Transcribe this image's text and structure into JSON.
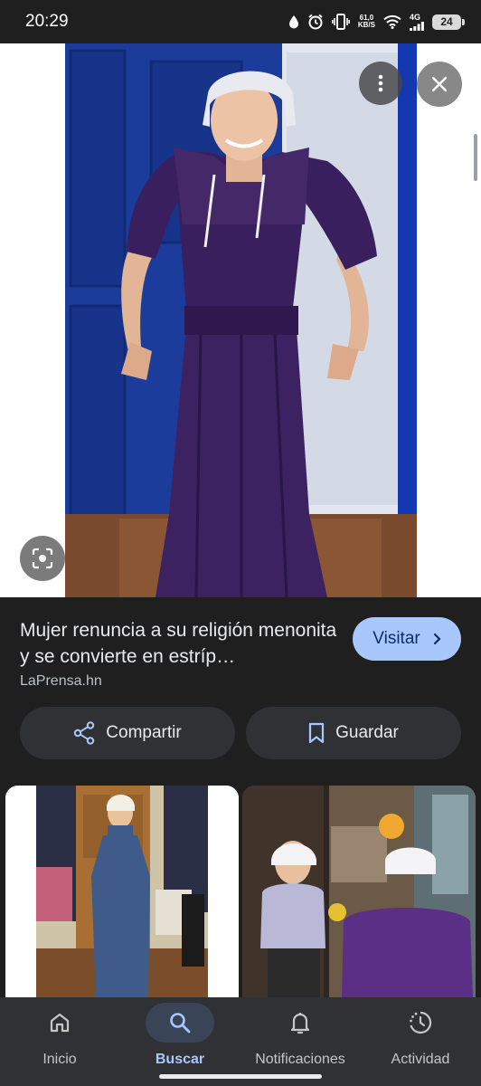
{
  "status_bar": {
    "time": "20:29",
    "net_speed_value": "61,0",
    "net_speed_unit": "KB/S",
    "network_type": "4G",
    "battery": "24"
  },
  "result": {
    "title": "Mujer renuncia a su religión menonita y se convierte en estríp…",
    "source": "LaPrensa.hn",
    "visit_label": "Visitar"
  },
  "actions": {
    "share_label": "Compartir",
    "save_label": "Guardar"
  },
  "nav": {
    "items": [
      {
        "label": "Inicio",
        "icon": "home-icon"
      },
      {
        "label": "Buscar",
        "icon": "search-icon",
        "active": true
      },
      {
        "label": "Notificaciones",
        "icon": "bell-icon"
      },
      {
        "label": "Actividad",
        "icon": "activity-icon"
      }
    ]
  },
  "colors": {
    "accent": "#a8c7fa",
    "background": "#1f1f1f",
    "surface": "#303134"
  }
}
